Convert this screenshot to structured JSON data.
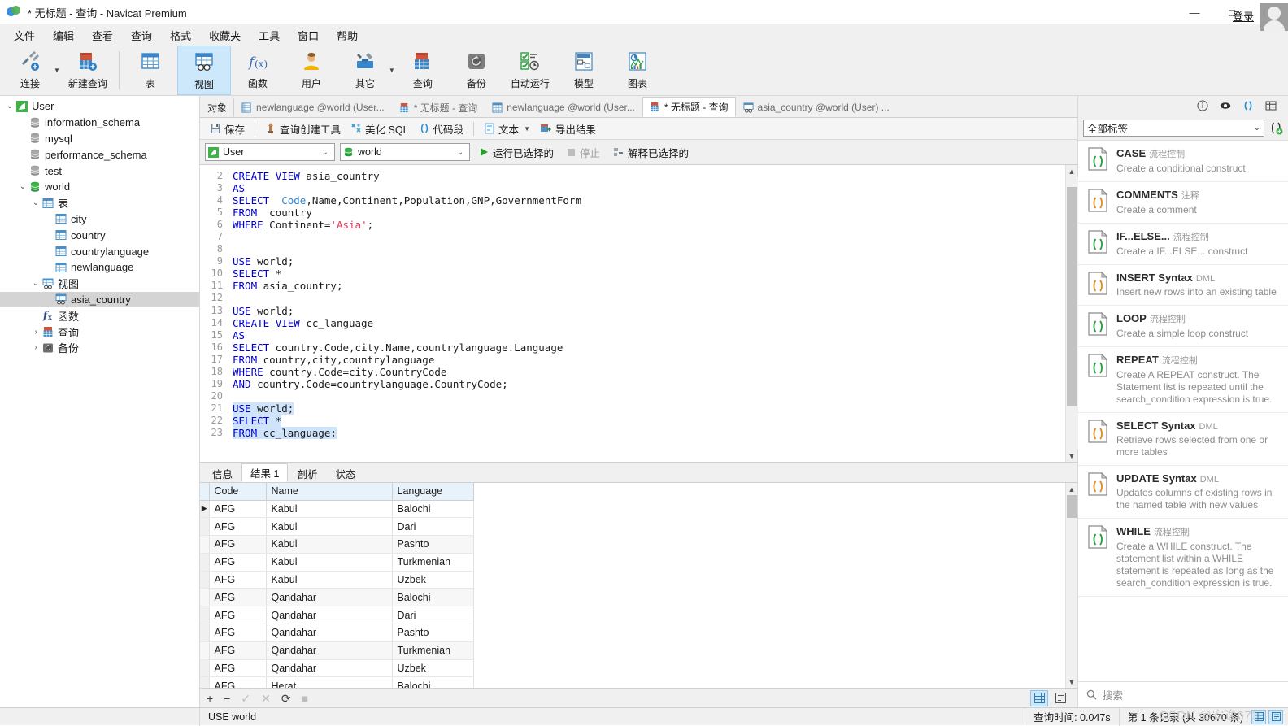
{
  "window": {
    "title": "* 无标题 - 查询 - Navicat Premium",
    "minimize": "—",
    "maximize": "□",
    "close": "✕"
  },
  "menu": {
    "items": [
      "文件",
      "编辑",
      "查看",
      "查询",
      "格式",
      "收藏夹",
      "工具",
      "窗口",
      "帮助"
    ],
    "login_label": "登录"
  },
  "toolbar": {
    "items": [
      {
        "label": "连接",
        "icon": "connect-icon",
        "caret": true,
        "selected": false
      },
      {
        "label": "新建查询",
        "icon": "new-query-icon",
        "caret": false,
        "selected": false
      },
      {
        "label": "表",
        "icon": "table-icon",
        "caret": false,
        "selected": false
      },
      {
        "label": "视图",
        "icon": "view-icon",
        "caret": false,
        "selected": true
      },
      {
        "label": "函数",
        "icon": "function-icon",
        "caret": false,
        "selected": false
      },
      {
        "label": "用户",
        "icon": "user-icon",
        "caret": false,
        "selected": false
      },
      {
        "label": "其它",
        "icon": "other-icon",
        "caret": true,
        "selected": false
      },
      {
        "label": "查询",
        "icon": "query-icon",
        "caret": false,
        "selected": false
      },
      {
        "label": "备份",
        "icon": "backup-icon",
        "caret": false,
        "selected": false
      },
      {
        "label": "自动运行",
        "icon": "automation-icon",
        "caret": false,
        "selected": false
      },
      {
        "label": "模型",
        "icon": "model-icon",
        "caret": false,
        "selected": false
      },
      {
        "label": "图表",
        "icon": "chart-icon",
        "caret": false,
        "selected": false
      }
    ]
  },
  "sidebar": {
    "nodes": [
      {
        "label": "User",
        "indent": 0,
        "icon": "connection-icon",
        "twisty": "down",
        "selected": false
      },
      {
        "label": "information_schema",
        "indent": 1,
        "icon": "database-icon",
        "twisty": "",
        "selected": false
      },
      {
        "label": "mysql",
        "indent": 1,
        "icon": "database-icon",
        "twisty": "",
        "selected": false
      },
      {
        "label": "performance_schema",
        "indent": 1,
        "icon": "database-icon",
        "twisty": "",
        "selected": false
      },
      {
        "label": "test",
        "indent": 1,
        "icon": "database-icon",
        "twisty": "",
        "selected": false
      },
      {
        "label": "world",
        "indent": 1,
        "icon": "database-open-icon",
        "twisty": "down",
        "selected": false
      },
      {
        "label": "表",
        "indent": 2,
        "icon": "table-icon",
        "twisty": "down",
        "selected": false
      },
      {
        "label": "city",
        "indent": 3,
        "icon": "table-icon",
        "twisty": "",
        "selected": false
      },
      {
        "label": "country",
        "indent": 3,
        "icon": "table-icon",
        "twisty": "",
        "selected": false
      },
      {
        "label": "countrylanguage",
        "indent": 3,
        "icon": "table-icon",
        "twisty": "",
        "selected": false
      },
      {
        "label": "newlanguage",
        "indent": 3,
        "icon": "table-icon",
        "twisty": "",
        "selected": false
      },
      {
        "label": "视图",
        "indent": 2,
        "icon": "view-icon",
        "twisty": "down",
        "selected": false
      },
      {
        "label": "asia_country",
        "indent": 3,
        "icon": "view-icon",
        "twisty": "",
        "selected": true
      },
      {
        "label": "函数",
        "indent": 2,
        "icon": "function-icon",
        "twisty": "",
        "selected": false
      },
      {
        "label": "查询",
        "indent": 2,
        "icon": "query-icon",
        "twisty": "right",
        "selected": false
      },
      {
        "label": "备份",
        "indent": 2,
        "icon": "backup-icon",
        "twisty": "right",
        "selected": false
      }
    ]
  },
  "tabs": [
    {
      "label": "对象",
      "icon": "",
      "active": false,
      "kind": "object"
    },
    {
      "label": "newlanguage @world (User...",
      "icon": "design-icon",
      "active": false,
      "kind": "normal"
    },
    {
      "label": "* 无标题 - 查询",
      "icon": "query-icon",
      "active": false,
      "kind": "normal"
    },
    {
      "label": "newlanguage @world (User...",
      "icon": "table-icon",
      "active": false,
      "kind": "normal"
    },
    {
      "label": "* 无标题 - 查询",
      "icon": "query-icon",
      "active": true,
      "kind": "normal"
    },
    {
      "label": "asia_country @world (User) ...",
      "icon": "view-icon",
      "active": false,
      "kind": "normal"
    }
  ],
  "editor_toolbar": {
    "save": "保存",
    "query_builder": "查询创建工具",
    "beautify": "美化 SQL",
    "snippet": "代码段",
    "text": "文本",
    "export": "导出结果"
  },
  "connection_bar": {
    "connection": "User",
    "database": "world",
    "run_selected": "运行已选择的",
    "stop": "停止",
    "explain_selected": "解释已选择的"
  },
  "sql": {
    "first_line_number": 2,
    "lines": [
      {
        "n": 2,
        "text": "CREATE VIEW asia_country"
      },
      {
        "n": 3,
        "text": "AS"
      },
      {
        "n": 4,
        "text": "SELECT  Code,Name,Continent,Population,GNP,GovernmentForm"
      },
      {
        "n": 5,
        "text": "FROM  country"
      },
      {
        "n": 6,
        "text": "WHERE Continent='Asia';"
      },
      {
        "n": 7,
        "text": ""
      },
      {
        "n": 8,
        "text": ""
      },
      {
        "n": 9,
        "text": "USE world;"
      },
      {
        "n": 10,
        "text": "SELECT *"
      },
      {
        "n": 11,
        "text": "FROM asia_country;"
      },
      {
        "n": 12,
        "text": ""
      },
      {
        "n": 13,
        "text": "USE world;"
      },
      {
        "n": 14,
        "text": "CREATE VIEW cc_language"
      },
      {
        "n": 15,
        "text": "AS"
      },
      {
        "n": 16,
        "text": "SELECT country.Code,city.Name,countrylanguage.Language"
      },
      {
        "n": 17,
        "text": "FROM country,city,countrylanguage"
      },
      {
        "n": 18,
        "text": "WHERE country.Code=city.CountryCode"
      },
      {
        "n": 19,
        "text": "AND country.Code=countrylanguage.CountryCode;"
      },
      {
        "n": 20,
        "text": ""
      },
      {
        "n": 21,
        "text": "USE world;",
        "selected": true
      },
      {
        "n": 22,
        "text": "SELECT *",
        "selected": true
      },
      {
        "n": 23,
        "text": "FROM cc_language;",
        "selected": true
      }
    ]
  },
  "results": {
    "tabs": [
      {
        "label": "信息",
        "active": false
      },
      {
        "label": "结果 1",
        "active": true
      },
      {
        "label": "剖析",
        "active": false
      },
      {
        "label": "状态",
        "active": false
      }
    ],
    "columns": [
      "Code",
      "Name",
      "Language"
    ],
    "rows": [
      [
        "AFG",
        "Kabul",
        "Balochi"
      ],
      [
        "AFG",
        "Kabul",
        "Dari"
      ],
      [
        "AFG",
        "Kabul",
        "Pashto"
      ],
      [
        "AFG",
        "Kabul",
        "Turkmenian"
      ],
      [
        "AFG",
        "Kabul",
        "Uzbek"
      ],
      [
        "AFG",
        "Qandahar",
        "Balochi"
      ],
      [
        "AFG",
        "Qandahar",
        "Dari"
      ],
      [
        "AFG",
        "Qandahar",
        "Pashto"
      ],
      [
        "AFG",
        "Qandahar",
        "Turkmenian"
      ],
      [
        "AFG",
        "Qandahar",
        "Uzbek"
      ],
      [
        "AFG",
        "Herat",
        "Balochi"
      ]
    ],
    "current_row_index": 0,
    "grid_toolbar": [
      "+",
      "−",
      "✓",
      "✕",
      "⟳",
      "■"
    ]
  },
  "right_panel": {
    "tag_filter": "全部标签",
    "search_placeholder": "搜索",
    "snippets": [
      {
        "title": "CASE",
        "category": "流程控制",
        "desc": "Create a conditional construct",
        "color": "#22a03c"
      },
      {
        "title": "COMMENTS",
        "category": "注释",
        "desc": "Create a comment",
        "color": "#e08a1e"
      },
      {
        "title": "IF...ELSE...",
        "category": "流程控制",
        "desc": "Create a IF...ELSE... construct",
        "color": "#22a03c"
      },
      {
        "title": "INSERT Syntax",
        "category": "DML",
        "desc": "Insert new rows into an existing table",
        "color": "#e08a1e"
      },
      {
        "title": "LOOP",
        "category": "流程控制",
        "desc": "Create a simple loop construct",
        "color": "#22a03c"
      },
      {
        "title": "REPEAT",
        "category": "流程控制",
        "desc": "Create A REPEAT construct. The Statement list is repeated until the search_condition expression is true.",
        "color": "#22a03c"
      },
      {
        "title": "SELECT Syntax",
        "category": "DML",
        "desc": "Retrieve rows selected from one or more tables",
        "color": "#e08a1e"
      },
      {
        "title": "UPDATE Syntax",
        "category": "DML",
        "desc": "Updates columns of existing rows in the named table with new values",
        "color": "#e08a1e"
      },
      {
        "title": "WHILE",
        "category": "流程控制",
        "desc": "Create a WHILE construct. The statement list within a WHILE statement is repeated as long as the search_condition expression is true.",
        "color": "#22a03c"
      }
    ]
  },
  "statusbar": {
    "message": "USE world",
    "query_time": "查询时间: 0.047s",
    "record_info": "第 1 条记录 (共 30670 条)",
    "watermark": "CSDN @安逸671"
  },
  "colors": {
    "accent": "#cde8fb",
    "selection": "#cfe4fb",
    "keyword": "#0000d0",
    "string": "#e8345a",
    "column": "#2f84d8",
    "header": "#e8f2fb"
  }
}
